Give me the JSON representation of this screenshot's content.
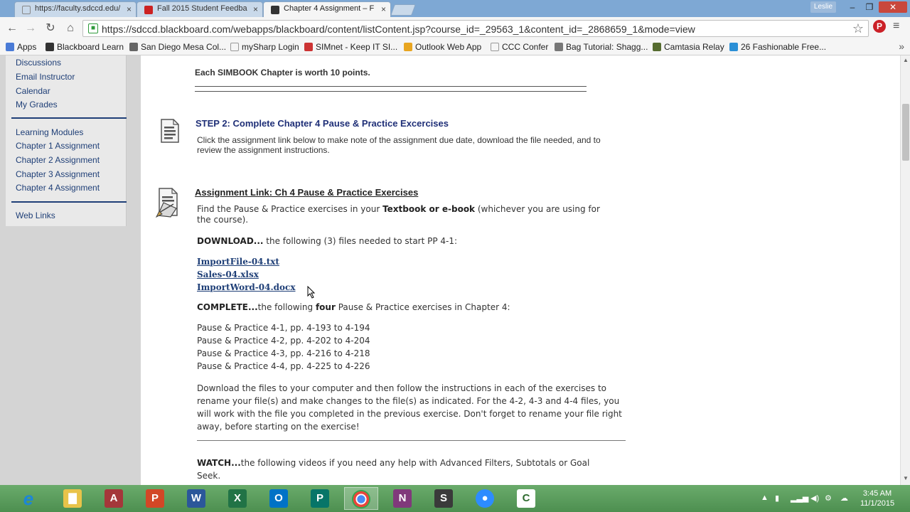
{
  "tabs": [
    {
      "label": "https://faculty.sdccd.edu/",
      "favicon_color": "#888888"
    },
    {
      "label": "Fall 2015 Student Feedba",
      "favicon_color": "#cc2222"
    },
    {
      "label": "Chapter 4 Assignment – F",
      "favicon_color": "#333333"
    }
  ],
  "window": {
    "user": "Leslie"
  },
  "address_bar": {
    "url": "https://sdccd.blackboard.com/webapps/blackboard/content/listContent.jsp?course_id=_29563_1&content_id=_2868659_1&mode=view"
  },
  "bookmarks": [
    {
      "label": "Apps",
      "color": "#4a7bd6"
    },
    {
      "label": "Blackboard Learn",
      "color": "#333333"
    },
    {
      "label": "San Diego Mesa Col...",
      "color": "#666666"
    },
    {
      "label": "mySharp Login",
      "color": "#dddddd"
    },
    {
      "label": "SIMnet - Keep IT SI...",
      "color": "#cc3333"
    },
    {
      "label": "Outlook Web App",
      "color": "#e8a520"
    },
    {
      "label": "CCC Confer",
      "color": "#dddddd"
    },
    {
      "label": "Bag Tutorial: Shagg...",
      "color": "#777777"
    },
    {
      "label": "Camtasia Relay",
      "color": "#556b2f"
    },
    {
      "label": "26 Fashionable Free...",
      "color": "#2b8fd6"
    }
  ],
  "sidebar": {
    "items": [
      {
        "label": "Discussions"
      },
      {
        "label": "Email Instructor"
      },
      {
        "label": "Calendar"
      },
      {
        "label": "My Grades"
      },
      {
        "label": "Learning Modules"
      },
      {
        "label": "Chapter 1 Assignment"
      },
      {
        "label": "Chapter 2 Assignment"
      },
      {
        "label": "Chapter 3 Assignment"
      },
      {
        "label": "Chapter 4 Assignment"
      },
      {
        "label": "Web Links"
      }
    ]
  },
  "content": {
    "simbook_note": "Each SIMBOOK Chapter is worth 10 points.",
    "step2": {
      "title": "STEP 2: Complete Chapter 4 Pause & Practice Excercises",
      "description": "Click the assignment link below to make note of the assignment due date, download the file needed, and to review the assignment instructions."
    },
    "assignment": {
      "title": "Assignment Link: Ch 4 Pause & Practice Exercises",
      "find_prefix": "Find the Pause & Practice exercises in your ",
      "find_bold": "Textbook or e-book",
      "find_suffix": " (whichever you are using for",
      "find_line2": "the course).",
      "download_bold": "DOWNLOAD...",
      "download_text": " the following (3) files needed to start PP 4-1:",
      "files": [
        "ImportFile-04.txt",
        "Sales-04.xlsx",
        "ImportWord-04.docx"
      ],
      "complete_bold": "COMPLETE...",
      "complete_text_a": "the following ",
      "complete_four": "four",
      "complete_text_b": " Pause & Practice exercises in Chapter 4:",
      "exercises": [
        "Pause & Practice 4-1, pp. 4-193 to 4-194",
        "Pause & Practice 4-2, pp. 4-202 to 4-204",
        "Pause & Practice 4-3, pp. 4-216 to 4-218",
        "Pause & Practice 4-4, pp. 4-225 to 4-226"
      ],
      "instructions": "Download the files to your computer and then follow the instructions in each of the exercises to rename your file(s) and make changes to the file(s) as indicated. For the 4-2, 4-3 and 4-4 files, you will work with the file you completed in the previous exercise.  Don't forget to rename your file right away, before starting on the exercise!",
      "watch_bold": "WATCH...",
      "watch_text": "the following videos if you need any help with Advanced Filters, Subtotals or Goal",
      "watch_line2": "Seek."
    }
  },
  "taskbar": {
    "apps": [
      {
        "name": "internet-explorer",
        "glyph": "e",
        "color": "#1d86d6"
      },
      {
        "name": "file-explorer",
        "glyph": "▇",
        "color": "#e8c34a"
      },
      {
        "name": "access",
        "glyph": "A",
        "color": "#a4373a"
      },
      {
        "name": "powerpoint",
        "glyph": "P",
        "color": "#d24726"
      },
      {
        "name": "word",
        "glyph": "W",
        "color": "#2b579a"
      },
      {
        "name": "excel",
        "glyph": "X",
        "color": "#217346"
      },
      {
        "name": "outlook",
        "glyph": "O",
        "color": "#0072c6"
      },
      {
        "name": "publisher",
        "glyph": "P",
        "color": "#077568"
      },
      {
        "name": "chrome",
        "glyph": "●",
        "color": "#4caf50"
      },
      {
        "name": "onenote",
        "glyph": "N",
        "color": "#80397b"
      },
      {
        "name": "snagit",
        "glyph": "S",
        "color": "#3a3a3a"
      },
      {
        "name": "zoom",
        "glyph": "●",
        "color": "#2d8cff"
      },
      {
        "name": "camtasia",
        "glyph": "C",
        "color": "#2f6b2f"
      }
    ],
    "clock": {
      "time": "3:45 AM",
      "date": "11/1/2015"
    }
  }
}
